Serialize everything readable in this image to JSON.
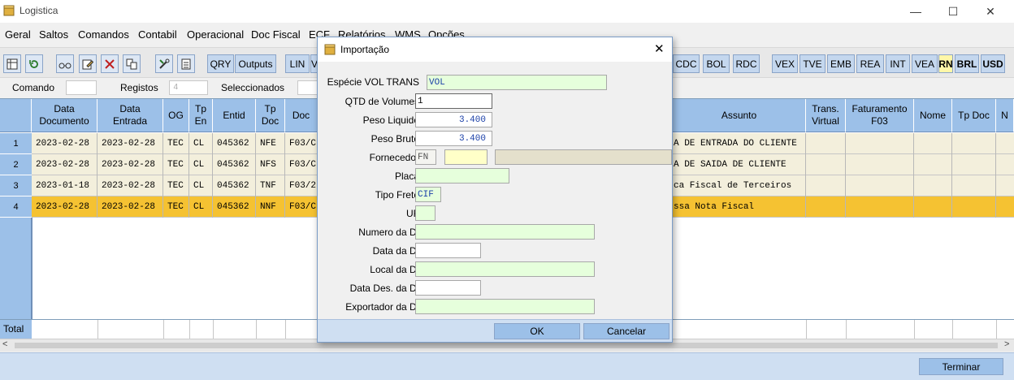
{
  "window": {
    "title": "Logistica",
    "minimize": "—",
    "maximize": "☐",
    "close": "✕"
  },
  "menu": [
    "Geral",
    "Saltos",
    "Comandos",
    "Contabil",
    "Operacional",
    "Doc Fiscal",
    "ECF",
    "Relatórios",
    "WMS",
    "Opções"
  ],
  "toolbar": {
    "text_buttons_left": [
      "QRY",
      "Outputs",
      "LIN",
      "V"
    ],
    "text_buttons_right": [
      "CDC",
      "BOL",
      "RDC",
      "VEX",
      "TVE",
      "EMB",
      "REA",
      "INT",
      "VEA",
      "RN",
      "BRL",
      "USD"
    ],
    "icons": [
      "table-search-icon",
      "refresh-icon",
      "glasses-icon",
      "edit-icon",
      "delete-icon",
      "copy-icon",
      "tools-icon",
      "calculator-icon"
    ]
  },
  "info": {
    "comando_label": "Comando",
    "comando_value": "",
    "registos_label": "Registos",
    "registos_value": "4",
    "seleccionados_label": "Seleccionados"
  },
  "grid": {
    "headers": {
      "data_documento": "Data\nDocumento",
      "data_entrada": "Data\nEntrada",
      "og": "OG",
      "tp_en": "Tp\nEn",
      "entid": "Entid",
      "tp_doc": "Tp\nDoc",
      "doc": "Doc",
      "assunto": "Assunto",
      "trans_virtual": "Trans.\nVirtual",
      "faturamento": "Faturamento\nF03",
      "nome": "Nome",
      "tp_doc2": "Tp Doc",
      "n": "N"
    },
    "rows": [
      {
        "n": "1",
        "data_documento": "2023-02-28",
        "data_entrada": "2023-02-28",
        "og": "TEC",
        "tp_en": "CL",
        "entid": "045362",
        "tp_doc": "NFE",
        "doc": "F03/C",
        "assunto": "A DE ENTRADA DO CLIENTE"
      },
      {
        "n": "2",
        "data_documento": "2023-02-28",
        "data_entrada": "2023-02-28",
        "og": "TEC",
        "tp_en": "CL",
        "entid": "045362",
        "tp_doc": "NFS",
        "doc": "F03/C",
        "assunto": "A DE SAIDA DE CLIENTE"
      },
      {
        "n": "3",
        "data_documento": "2023-01-18",
        "data_entrada": "2023-02-28",
        "og": "TEC",
        "tp_en": "CL",
        "entid": "045362",
        "tp_doc": "TNF",
        "doc": "F03/2",
        "assunto": "ca Fiscal de Terceiros"
      },
      {
        "n": "4",
        "data_documento": "2023-02-28",
        "data_entrada": "2023-02-28",
        "og": "TEC",
        "tp_en": "CL",
        "entid": "045362",
        "tp_doc": "NNF",
        "doc": "F03/C",
        "assunto": "ssa Nota Fiscal"
      }
    ],
    "total_label": "Total"
  },
  "footer": {
    "terminar": "Terminar"
  },
  "dialog": {
    "title": "Importação",
    "close": "✕",
    "fields": {
      "especie_label": "Espécie VOL TRANS",
      "especie_value": "VOL",
      "qtd_label": "QTD de Volumes",
      "qtd_value": "1",
      "peso_liquido_label": "Peso Liquido",
      "peso_liquido_value": "3.400",
      "peso_bruto_label": "Peso Bruto",
      "peso_bruto_value": "3.400",
      "fornecedor_label": "Fornecedor",
      "fornecedor_value": "FN",
      "fornecedor_code": "",
      "fornecedor_name": "",
      "placa_label": "Placa",
      "placa_value": "",
      "tipo_frete_label": "Tipo Frete",
      "tipo_frete_value": "CIF",
      "uf_label": "UF",
      "uf_value": "",
      "numero_di_label": "Numero da DI",
      "numero_di_value": "",
      "data_di_label": "Data da DI",
      "data_di_value": "",
      "local_di_label": "Local da DI",
      "local_di_value": "",
      "data_des_di_label": "Data Des. da DI",
      "data_des_di_value": "",
      "exportador_di_label": "Exportador da DI",
      "exportador_di_value": ""
    },
    "ok": "OK",
    "cancel": "Cancelar"
  }
}
